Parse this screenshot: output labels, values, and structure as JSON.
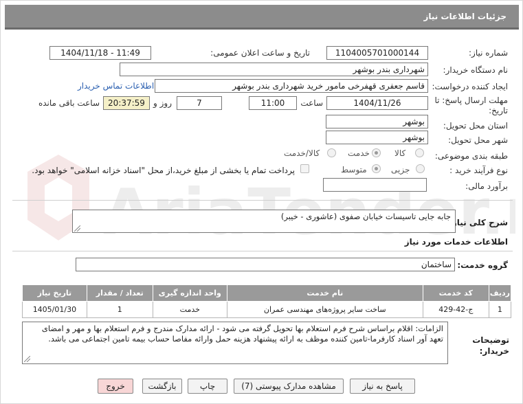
{
  "header": {
    "title": "جزئیات اطلاعات نیاز"
  },
  "fields": {
    "need_number_label": "شماره نیاز:",
    "need_number": "1104005701000144",
    "announce_label": "تاریخ و ساعت اعلان عمومی:",
    "announce_value": "1404/11/18 - 11:49",
    "buyer_org_label": "نام دستگاه خریدار:",
    "buyer_org": "شهرداری بندر بوشهر",
    "requester_label": "ایجاد کننده درخواست:",
    "requester": "قاسم جعفری قهفرخی مامور خرید  شهرداری بندر بوشهر",
    "contact_link": "اطلاعات تماس خریدار",
    "deadline_label_1": "مهلت ارسال پاسخ: تا",
    "deadline_label_2": "تاریخ:",
    "deadline_date": "1404/11/26",
    "time_label": "ساعت",
    "deadline_time": "11:00",
    "days": "7",
    "days_label": "روز و",
    "remaining_time": "20:37:59",
    "remaining_label": "ساعت باقی مانده",
    "province_label": "استان محل تحویل:",
    "province": "بوشهر",
    "city_label": "شهر محل تحویل:",
    "city": "بوشهر",
    "category_label": "طبقه بندی موضوعی:",
    "category_options": [
      "کالا",
      "خدمت",
      "کالا/خدمت"
    ],
    "category_selected": "خدمت",
    "process_label": "نوع فرآیند خرید :",
    "process_options": [
      "جزیی",
      "متوسط"
    ],
    "process_selected": "متوسط",
    "payment_note": "پرداخت تمام یا بخشی از مبلغ خرید،از محل \"اسناد خزانه اسلامی\" خواهد بود.",
    "estimate_label": "برآورد مالی:",
    "estimate_value": ""
  },
  "summary": {
    "label": "شرح کلی نیاز:",
    "text": "جابه جایی تاسیسات خیابان صفوی (عاشوری - خیبر)"
  },
  "services": {
    "section_title": "اطلاعات خدمات مورد نیاز",
    "group_label": "گروه خدمت:",
    "group_value": "ساختمان",
    "columns": [
      "ردیف",
      "کد خدمت",
      "نام خدمت",
      "واحد اندازه گیری",
      "تعداد / مقدار",
      "تاریخ نیاز"
    ],
    "rows": [
      {
        "row": "1",
        "code": "ج-42-429",
        "name": "ساخت سایر پروژه‌های مهندسی عمران",
        "unit": "خدمت",
        "qty": "1",
        "date": "1405/01/30"
      }
    ]
  },
  "notes": {
    "label_1": "توضیحات",
    "label_2": "خریدار:",
    "text": "الزامات: اقلام براساس شرح فرم استعلام بها تحویل گرفته می شود - ارائه مدارک مندرج و فرم استعلام بها و مهر و امضای تعهد آور اسناد کارفرما-تامین کننده موظف به ارائه پیشنهاد هزینه حمل وارائه مفاصا حساب بیمه تامین اجتماعی می باشد."
  },
  "buttons": {
    "reply": "پاسخ به نیاز",
    "view_docs": "مشاهده مدارک پیوستی (7)",
    "print": "چاپ",
    "back": "بازگشت",
    "exit": "خروج"
  },
  "watermark": "AriaTender.net",
  "colors": {
    "header_bg": "#8c8c8c",
    "table_header_bg": "#9a9a9a",
    "highlight": "#f5f0c8",
    "link": "#2a5fb0",
    "exit_bg": "#f8d6d6"
  }
}
